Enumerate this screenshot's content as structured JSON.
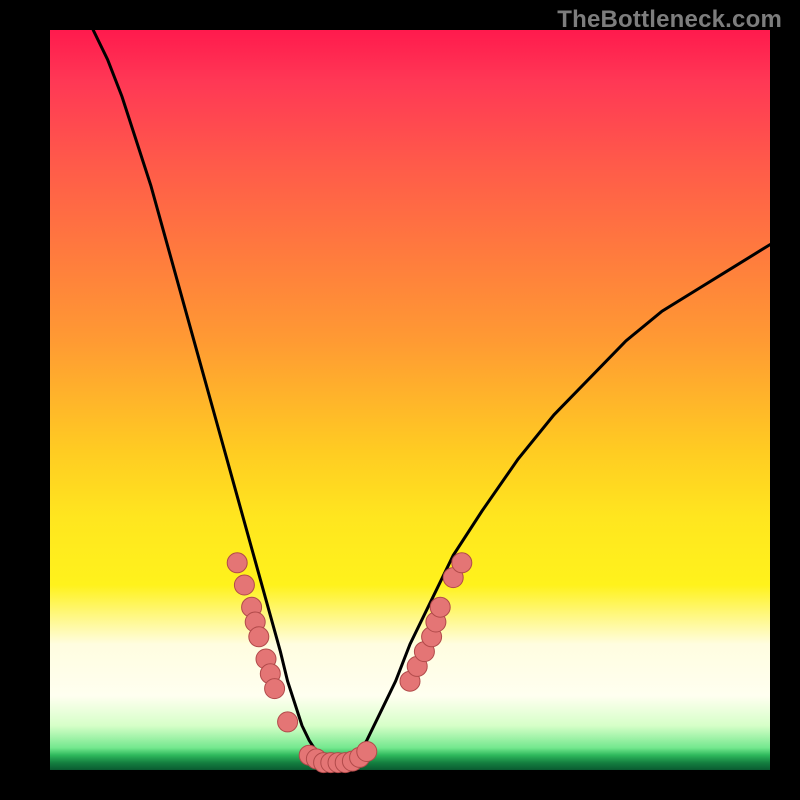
{
  "watermark": "TheBottleneck.com",
  "chart_data": {
    "type": "line",
    "title": "",
    "xlabel": "",
    "ylabel": "",
    "xlim": [
      0,
      100
    ],
    "ylim": [
      0,
      100
    ],
    "grid": false,
    "series": [
      {
        "name": "bottleneck-curve",
        "x": [
          6,
          8,
          10,
          12,
          14,
          16,
          18,
          20,
          22,
          24,
          26,
          28,
          30,
          32,
          33,
          34,
          35,
          36,
          37,
          38,
          39,
          40,
          41,
          42,
          43,
          44,
          46,
          48,
          50,
          53,
          56,
          60,
          65,
          70,
          75,
          80,
          85,
          90,
          95,
          100
        ],
        "y": [
          100,
          96,
          91,
          85,
          79,
          72,
          65,
          58,
          51,
          44,
          37,
          30,
          23,
          16,
          12,
          9,
          6,
          4,
          2.5,
          1.5,
          1,
          1,
          1,
          1.5,
          2.5,
          4,
          8,
          12,
          17,
          23,
          29,
          35,
          42,
          48,
          53,
          58,
          62,
          65,
          68,
          71
        ]
      }
    ],
    "markers": [
      {
        "name": "left-cluster",
        "points": [
          {
            "x": 26,
            "y": 28
          },
          {
            "x": 27,
            "y": 25
          },
          {
            "x": 28,
            "y": 22
          },
          {
            "x": 28.5,
            "y": 20
          },
          {
            "x": 29,
            "y": 18
          },
          {
            "x": 30,
            "y": 15
          },
          {
            "x": 30.6,
            "y": 13
          },
          {
            "x": 31.2,
            "y": 11
          },
          {
            "x": 33,
            "y": 6.5
          },
          {
            "x": 36,
            "y": 2
          },
          {
            "x": 37,
            "y": 1.5
          },
          {
            "x": 38,
            "y": 1
          },
          {
            "x": 39,
            "y": 1
          },
          {
            "x": 40,
            "y": 1
          },
          {
            "x": 41,
            "y": 1
          },
          {
            "x": 42,
            "y": 1.2
          },
          {
            "x": 43,
            "y": 1.7
          },
          {
            "x": 44,
            "y": 2.5
          }
        ]
      },
      {
        "name": "right-cluster",
        "points": [
          {
            "x": 50,
            "y": 12
          },
          {
            "x": 51,
            "y": 14
          },
          {
            "x": 52,
            "y": 16
          },
          {
            "x": 53,
            "y": 18
          },
          {
            "x": 53.6,
            "y": 20
          },
          {
            "x": 54.2,
            "y": 22
          },
          {
            "x": 56,
            "y": 26
          },
          {
            "x": 57.2,
            "y": 28
          }
        ]
      }
    ],
    "colors": {
      "curve": "#000000",
      "marker_fill": "#e47575",
      "marker_stroke": "#b14a4a"
    }
  }
}
